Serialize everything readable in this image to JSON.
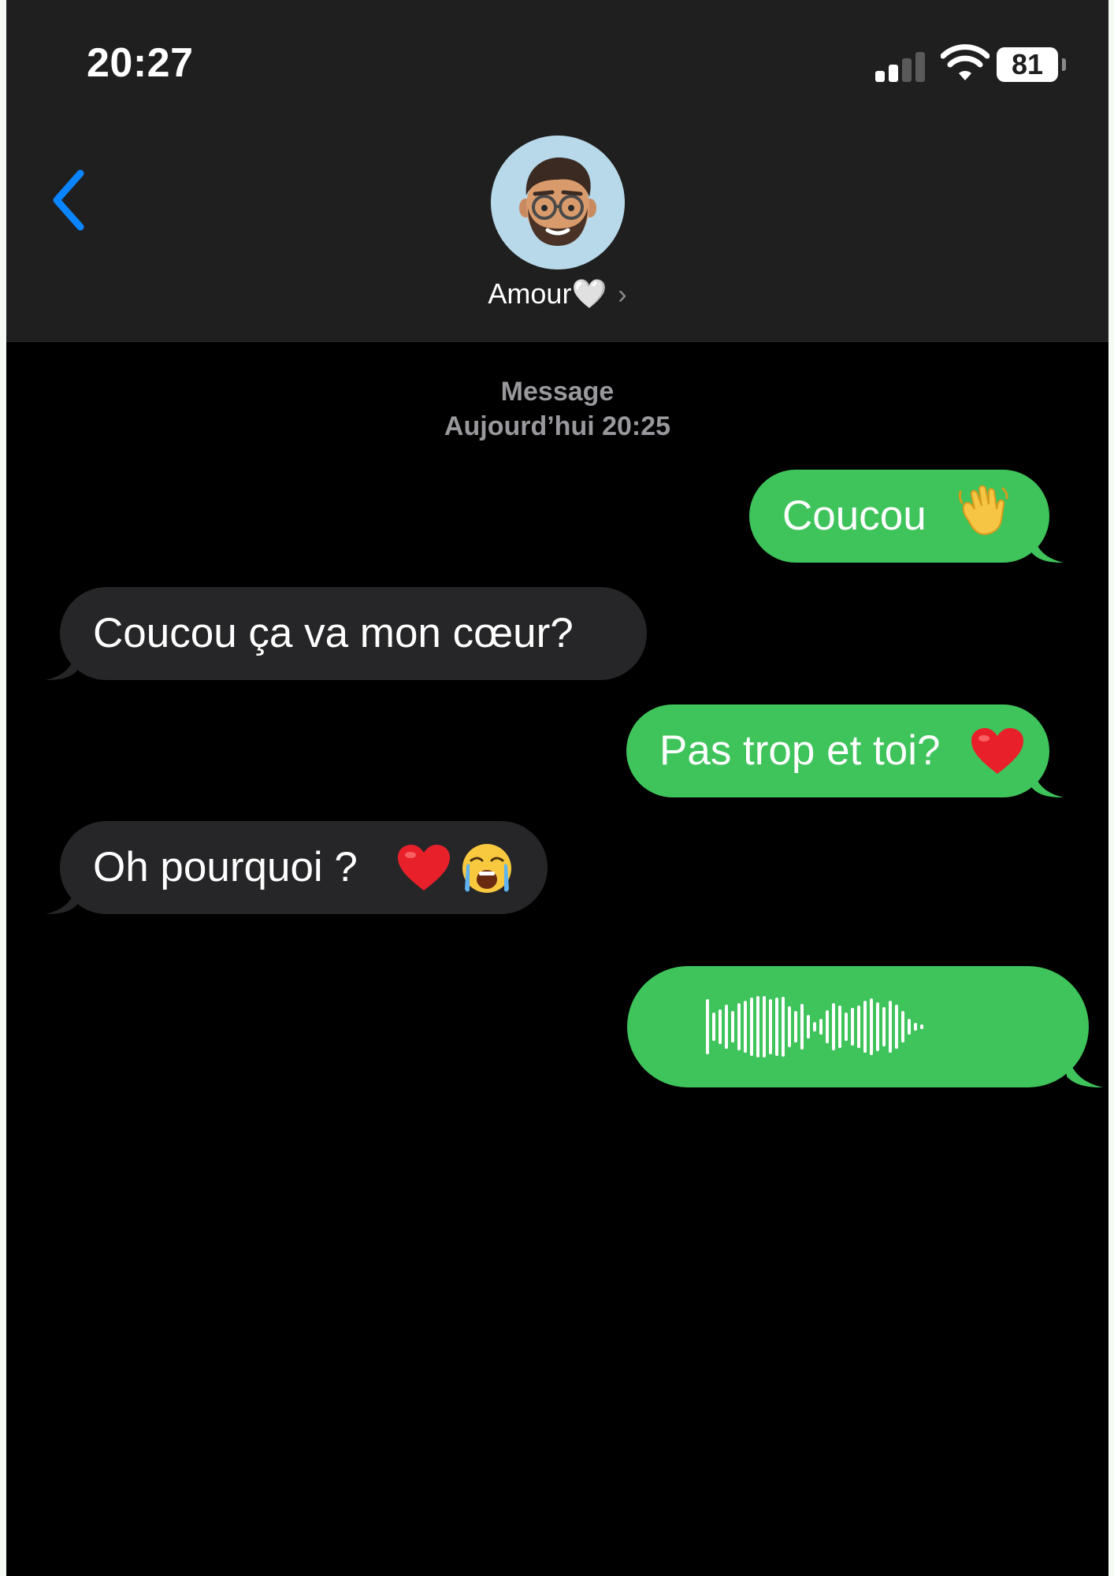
{
  "status_bar": {
    "time": "20:27",
    "battery": "81",
    "icons": [
      "cellular-signal-icon",
      "wifi-icon",
      "battery-icon"
    ]
  },
  "header": {
    "back_icon": "chevron-left-icon",
    "contact_name": "Amour🤍",
    "chevron": "›",
    "avatar": "memoji-avatar"
  },
  "conversation": {
    "service": "Message",
    "date": "Aujourd’hui 20:25",
    "messages": [
      {
        "direction": "sent",
        "text": "Coucou ",
        "emoji": "waving-hand-emoji"
      },
      {
        "direction": "received",
        "text": "Coucou ça va mon cœur?"
      },
      {
        "direction": "sent",
        "text": "Pas trop et toi?",
        "emoji": "red-heart-emoji"
      },
      {
        "direction": "received",
        "text": "Oh pourquoi ? ",
        "emoji": [
          "red-heart-emoji",
          "loudly-crying-face-emoji"
        ]
      },
      {
        "direction": "sent",
        "type": "voice-message",
        "icon": "audio-waveform"
      }
    ]
  },
  "colors": {
    "sent_bubble": "#3fc35b",
    "received_bubble": "#262628",
    "accent_blue": "#0a84ff",
    "header_bg": "#1f1f1f",
    "background": "#000000"
  }
}
